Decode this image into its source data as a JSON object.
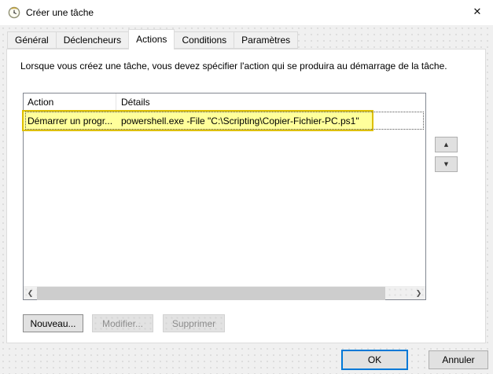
{
  "window": {
    "title": "Créer une tâche"
  },
  "icons": {
    "close": "✕",
    "up": "▲",
    "down": "▼",
    "scroll_left": "❮",
    "scroll_right": "❯"
  },
  "tabs": [
    {
      "label": "Général",
      "active": false
    },
    {
      "label": "Déclencheurs",
      "active": false
    },
    {
      "label": "Actions",
      "active": true
    },
    {
      "label": "Conditions",
      "active": false
    },
    {
      "label": "Paramètres",
      "active": false
    }
  ],
  "description": "Lorsque vous créez une tâche, vous devez spécifier l'action qui se produira au démarrage de la tâche.",
  "table": {
    "columns": [
      "Action",
      "Détails"
    ],
    "rows": [
      {
        "action": "Démarrer un progr...",
        "details": "powershell.exe -File \"C:\\Scripting\\Copier-Fichier-PC.ps1\"",
        "highlighted": true
      }
    ]
  },
  "action_buttons": [
    {
      "label": "Nouveau...",
      "enabled": true
    },
    {
      "label": "Modifier...",
      "enabled": false
    },
    {
      "label": "Supprimer",
      "enabled": false
    }
  ],
  "dialog_buttons": [
    {
      "label": "OK",
      "default": true
    },
    {
      "label": "Annuler",
      "default": false
    }
  ],
  "colors": {
    "highlight_fill": "#ffff9b",
    "highlight_border": "#ddbf00",
    "accent": "#0078d7",
    "dialog_background": "#f0f0f0"
  }
}
